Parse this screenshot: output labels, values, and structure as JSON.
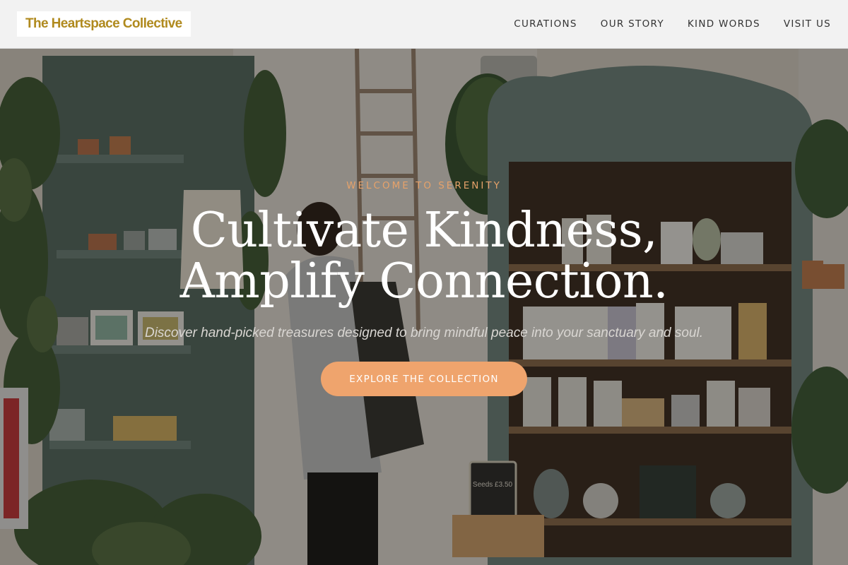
{
  "header": {
    "logo_text": "The Heartspace Collective",
    "nav": [
      "CURATIONS",
      "OUR STORY",
      "KIND WORDS",
      "VISIT US"
    ]
  },
  "hero": {
    "eyebrow": "WELCOME TO SERENITY",
    "headline_line1": "Cultivate Kindness,",
    "headline_line2": "Amplify Connection.",
    "subheadline": "Discover hand-picked treasures designed to bring mindful peace into your sanctuary and soul.",
    "cta_label": "EXPLORE THE COLLECTION",
    "background_image": "shop-interior-photo",
    "tag_text": "Seeds £3.50"
  },
  "colors": {
    "logo_text": "#b08a1e",
    "accent": "#efa46d",
    "eyebrow": "#e6a26a",
    "header_bg": "#f2f2f2",
    "cabinet": "#6f8680"
  }
}
